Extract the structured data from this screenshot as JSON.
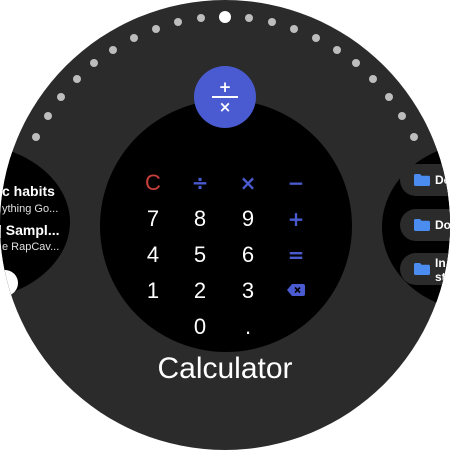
{
  "app": {
    "title": "Calculator",
    "badge_top": "+",
    "badge_bottom": "×"
  },
  "colors": {
    "accent": "#4a5bd1",
    "clear": "#c9403a",
    "background": "#2b2b2b"
  },
  "keypad": {
    "clear": "C",
    "divide": "÷",
    "multiply": "×",
    "minus": "−",
    "plus": "+",
    "equals": "=",
    "digits": [
      "7",
      "8",
      "9",
      "4",
      "5",
      "6",
      "1",
      "2",
      "3",
      "0",
      "."
    ],
    "backspace_icon": "backspace-icon"
  },
  "left_tile": {
    "item1_title": "c habits",
    "item1_sub": "ything Go...",
    "item2_title": "| Sampl...",
    "item2_sub": "e RapCav..."
  },
  "right_tile": {
    "chips": [
      {
        "label": "Do",
        "icon": "folder-icon"
      },
      {
        "label": "Do",
        "icon": "folder-icon"
      },
      {
        "label_line1": "In",
        "label_line2": "st",
        "icon": "folder-icon"
      }
    ]
  },
  "page_indicator": {
    "dot_count": 21,
    "active_index": 10
  }
}
